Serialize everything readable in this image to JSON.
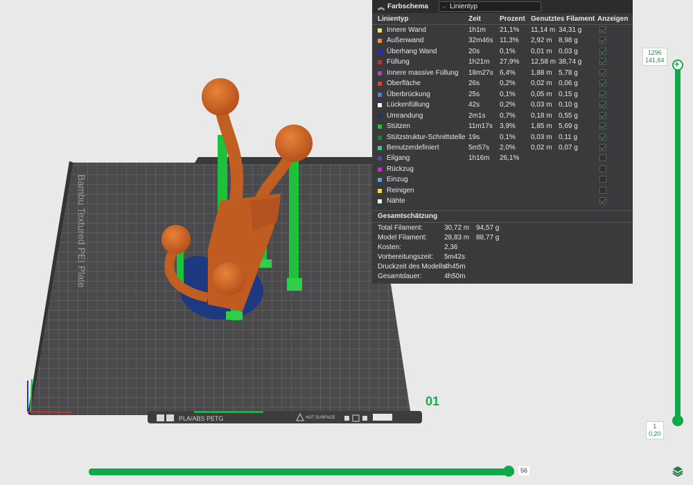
{
  "panel": {
    "title": "Farbschema",
    "dropdown": "Linientyp",
    "headers": [
      "Linientyp",
      "Zeit",
      "Prozent",
      "Genutztes Filament",
      "Anzeigen"
    ],
    "rows": [
      {
        "name": "Innere Wand",
        "color": "#f5e35a",
        "time": "1h1m",
        "pct": "21,1%",
        "len": "11,14 m",
        "weight": "34,31 g",
        "show": true
      },
      {
        "name": "Außenwand",
        "color": "#f08a3e",
        "time": "32m46s",
        "pct": "11,3%",
        "len": "2,92 m",
        "weight": "8,98 g",
        "show": true
      },
      {
        "name": "Überhang Wand",
        "color": "#1f2bd6",
        "time": "20s",
        "pct": "0,1%",
        "len": "0,01 m",
        "weight": "0,03 g",
        "show": true
      },
      {
        "name": "Füllung",
        "color": "#c0362c",
        "time": "1h21m",
        "pct": "27,9%",
        "len": "12,58 m",
        "weight": "38,74 g",
        "show": true
      },
      {
        "name": "Innere massive Füllung",
        "color": "#9a4fc0",
        "time": "18m27s",
        "pct": "6,4%",
        "len": "1,88 m",
        "weight": "5,78 g",
        "show": true
      },
      {
        "name": "Oberfläche",
        "color": "#e3413b",
        "time": "26s",
        "pct": "0,2%",
        "len": "0,02 m",
        "weight": "0,06 g",
        "show": true
      },
      {
        "name": "Überbrückung",
        "color": "#4f83c2",
        "time": "25s",
        "pct": "0,1%",
        "len": "0,05 m",
        "weight": "0,15 g",
        "show": true
      },
      {
        "name": "Lückenfüllung",
        "color": "#ffffff",
        "time": "42s",
        "pct": "0,2%",
        "len": "0,03 m",
        "weight": "0,10 g",
        "show": true
      },
      {
        "name": "Umrandung",
        "color": "#1a3a6a",
        "time": "2m1s",
        "pct": "0,7%",
        "len": "0,18 m",
        "weight": "0,55 g",
        "show": true
      },
      {
        "name": "Stützen",
        "color": "#22c53a",
        "time": "11m17s",
        "pct": "3,9%",
        "len": "1,85 m",
        "weight": "5,69 g",
        "show": true
      },
      {
        "name": "Stützstruktur-Schnittstelle",
        "color": "#2f7a2f",
        "time": "19s",
        "pct": "0,1%",
        "len": "0,03 m",
        "weight": "0,11 g",
        "show": true
      },
      {
        "name": "Benutzerdefiniert",
        "color": "#4ec08a",
        "time": "5m57s",
        "pct": "2,0%",
        "len": "0,02 m",
        "weight": "0,07 g",
        "show": true
      },
      {
        "name": "Eilgang",
        "color": "#4a4fa0",
        "time": "1h16m",
        "pct": "26,1%",
        "len": "",
        "weight": "",
        "show": false
      },
      {
        "name": "Rückzug",
        "color": "#c02fc0",
        "time": "",
        "pct": "",
        "len": "",
        "weight": "",
        "show": false
      },
      {
        "name": "Einzug",
        "color": "#4aa8d8",
        "time": "",
        "pct": "",
        "len": "",
        "weight": "",
        "show": false
      },
      {
        "name": "Reinigen",
        "color": "#f2e02a",
        "time": "",
        "pct": "",
        "len": "",
        "weight": "",
        "show": false
      },
      {
        "name": "Nähte",
        "color": "#f0f0f0",
        "time": "",
        "pct": "",
        "len": "",
        "weight": "",
        "show": true
      }
    ],
    "summary_title": "Gesamtschätzung",
    "summary": [
      {
        "label": "Total Filament:",
        "v1": "30,72 m",
        "v2": "94,57 g"
      },
      {
        "label": "Model Filament:",
        "v1": "28,83 m",
        "v2": "88,77 g"
      },
      {
        "label": "Kosten:",
        "v1": "2,36",
        "v2": ""
      },
      {
        "label": "Vorbereitungszeit:",
        "v1": "5m42s",
        "v2": ""
      },
      {
        "label": "Druckzeit des Modells:",
        "v1": "4h45m",
        "v2": ""
      },
      {
        "label": "Gesamtdauer:",
        "v1": "4h50m",
        "v2": ""
      }
    ]
  },
  "plate": {
    "name": "Bambu Textured PEI Plate",
    "number": "01",
    "filament_label": "PLA/ABS PETG",
    "surface_label": "HOT SURFACE"
  },
  "vertical_slider": {
    "top_layer": "1296",
    "top_height": "141,64",
    "bottom_layer": "1",
    "bottom_height": "0,20"
  },
  "horizontal_slider": {
    "value": "56"
  },
  "icons": {
    "collapse": "collapse-icon",
    "layers": "layers-icon",
    "plus": "plus-icon"
  }
}
